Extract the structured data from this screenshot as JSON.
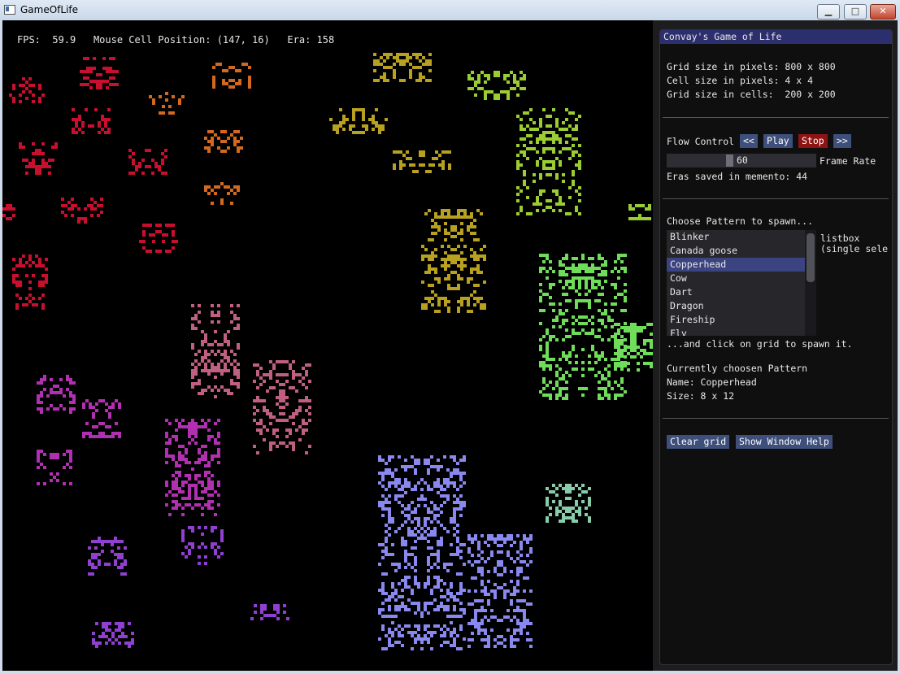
{
  "window": {
    "title": "GameOfLife",
    "min_label": "▁",
    "max_label": "□",
    "close_label": "✕"
  },
  "stats": {
    "fps_label": "FPS:",
    "fps_value": "59.9",
    "mouse_label": "Mouse Cell Position:",
    "mouse_value": "(147, 16)",
    "era_label": "Era:",
    "era_value": "158"
  },
  "panel": {
    "title": "Convay's Game of Life",
    "grid_pixels": "Grid size in pixels: 800 x 800",
    "cell_pixels": "Cell size in pixels: 4 x 4",
    "grid_cells": "Grid size in cells:  200 x 200",
    "flow_label": "Flow Control",
    "prev_btn": "<<",
    "play_btn": "Play",
    "stop_btn": "Stop",
    "next_btn": ">>",
    "frame_rate_value": "60",
    "frame_rate_label": "Frame Rate",
    "eras_saved": "Eras saved in memento: 44",
    "choose_label": "Choose Pattern to spawn...",
    "listbox_items": [
      "Blinker",
      "Canada goose",
      "Copperhead",
      "Cow",
      "Dart",
      "Dragon",
      "Fireship",
      "Fly"
    ],
    "listbox_selected": 2,
    "listbox_side_label_1": "listbox",
    "listbox_side_label_2": "(single sele",
    "spawn_hint": "...and click on grid to spawn it.",
    "current_label": "Currently choosen Pattern",
    "current_name": "Name: Copperhead",
    "current_size": "Size: 8 x 12",
    "clear_btn": "Clear grid",
    "help_btn": "Show Window Help"
  },
  "grid_colors": {
    "background": "#000000",
    "red": "#c8102e",
    "orange": "#d2691e",
    "yellow": "#b8a020",
    "lime": "#9acd32",
    "green": "#6fdc5a",
    "pink": "#c06080",
    "magenta": "#b030b0",
    "purple": "#9040d0",
    "lavender": "#8888ee",
    "seafoam": "#88ccaa"
  }
}
